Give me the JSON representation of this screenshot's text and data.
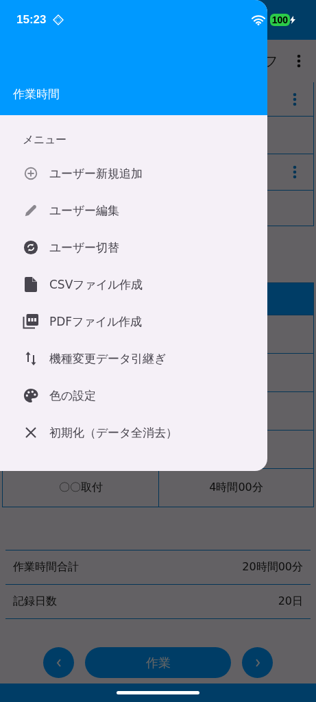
{
  "status_bar": {
    "time": "15:23",
    "battery": "100"
  },
  "drawer": {
    "title": "作業時間",
    "section": "メニュー",
    "items": [
      {
        "label": "ユーザー新規追加",
        "kind": "add"
      },
      {
        "label": "ユーザー編集",
        "kind": "edit"
      },
      {
        "label": "ユーザー切替",
        "kind": "switch"
      },
      {
        "label": "CSVファイル作成",
        "kind": "file"
      },
      {
        "label": "PDFファイル作成",
        "kind": "pdf"
      },
      {
        "label": "機種変更データ引継ぎ",
        "kind": "transfer"
      },
      {
        "label": "色の設定",
        "kind": "palette"
      },
      {
        "label": "初期化（データ全消去）",
        "kind": "clear"
      }
    ]
  },
  "background": {
    "app_bar_title": "フ",
    "table_row": [
      "〇〇取付",
      "4時間00分"
    ],
    "summary": [
      {
        "label": "作業時間合計",
        "value": "20時間00分"
      },
      {
        "label": "記録日数",
        "value": "20日"
      }
    ],
    "bottom_button": "作業"
  }
}
